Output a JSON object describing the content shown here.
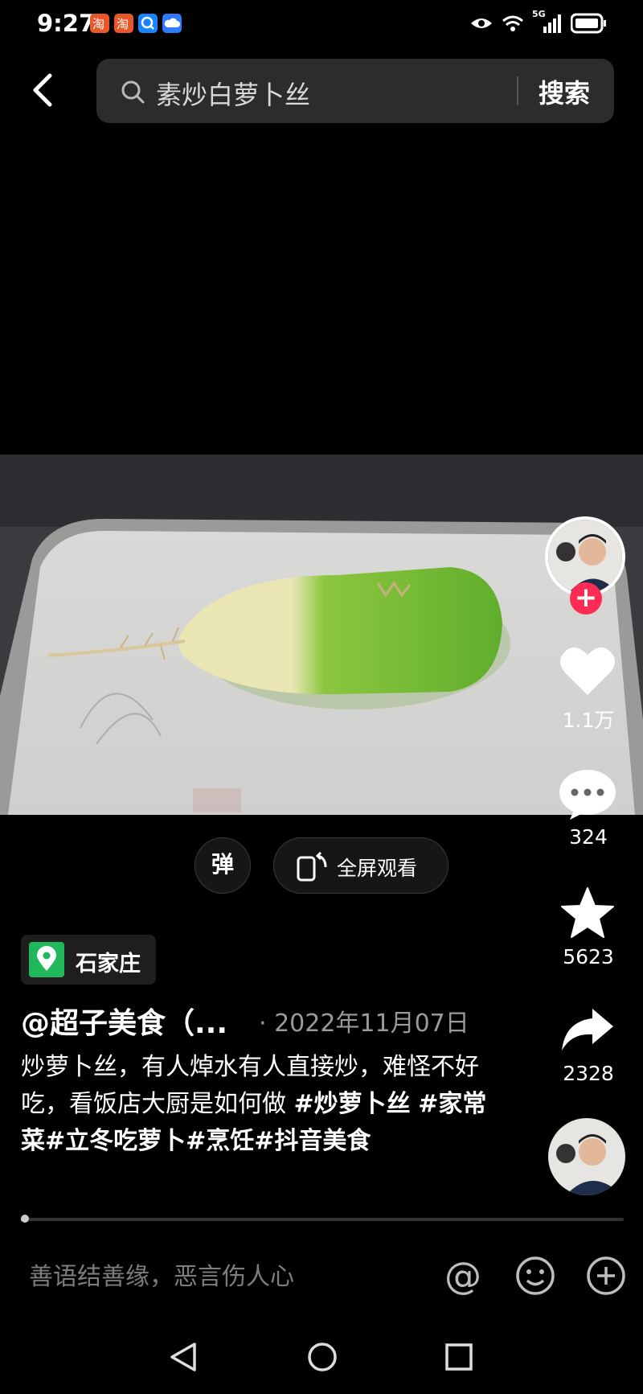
{
  "status_bar": {
    "time": "9:27",
    "left_icons": [
      "taobao-app-icon",
      "taobao-app-icon",
      "search-app-icon",
      "cloud-app-icon"
    ],
    "right_icons": [
      "eye-icon",
      "wifi-icon",
      "signal-5g-icon",
      "battery-icon"
    ],
    "network_label": "5G"
  },
  "search": {
    "query": "素炒白萝卜丝",
    "button_label": "搜索"
  },
  "actions": {
    "like_count": "1.1万",
    "comment_count": "324",
    "favorite_count": "5623",
    "share_count": "2328",
    "follow_symbol": "+"
  },
  "controls": {
    "danmaku_label": "弹",
    "fullscreen_label": "全屏观看"
  },
  "post": {
    "location": "石家庄",
    "author": "@超子美食（...",
    "date": "· 2022年11月07日",
    "caption_text": "炒萝卜丝，有人焯水有人直接炒，难怪不好吃，看饭店大厨是如何做 ",
    "tags": [
      "#炒萝卜丝",
      "#家常菜",
      "#立冬吃萝卜",
      "#烹饪",
      "#抖音美食"
    ]
  },
  "progress": {
    "fraction": 0.004
  },
  "comment": {
    "placeholder": "善语结善缘，恶言伤人心"
  },
  "colors": {
    "background": "#000000",
    "accent_red": "#fe2c55",
    "location_green": "#20b85a",
    "search_box": "#2c2c2e"
  }
}
